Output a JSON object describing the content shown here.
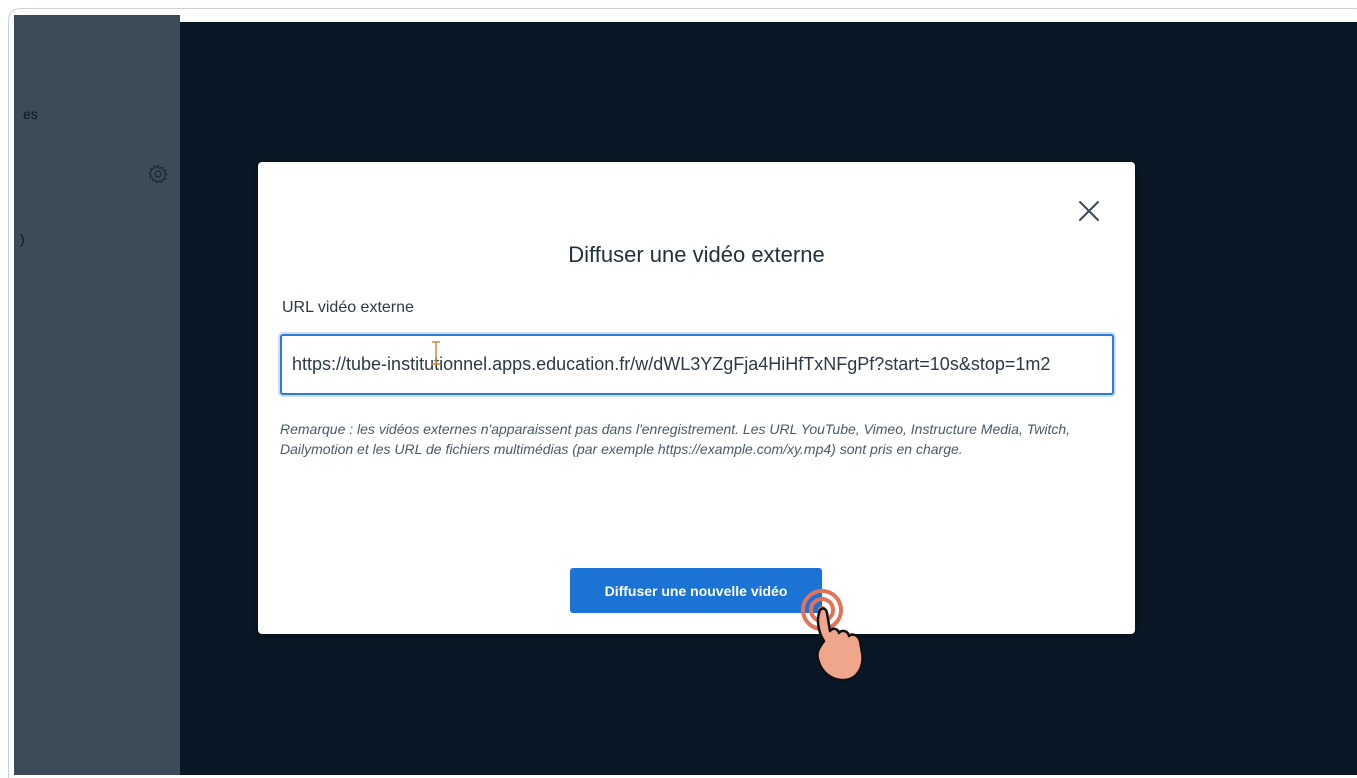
{
  "sidebar": {
    "partial_label_1": "es",
    "partial_label_2": ")",
    "settings_icon": "gear-icon"
  },
  "modal": {
    "title": "Diffuser une vidéo externe",
    "close_icon": "close-icon",
    "field_label": "URL vidéo externe",
    "url_value": "https://tube-institutionnel.apps.education.fr/w/dWL3YZgFja4HiHfTxNFgPf?start=10s&stop=1m2",
    "note": "Remarque : les vidéos externes n'apparaissent pas dans l'enregistrement. Les URL YouTube, Vimeo, Instructure Media, Twitch, Dailymotion et les URL de fichiers multimédias (par exemple https://example.com/xy.mp4) sont pris en charge.",
    "submit_label": "Diffuser une nouvelle vidéo"
  },
  "colors": {
    "sidebar": "#3d4b59",
    "backdrop": "#0a1726",
    "accent": "#1b73d6",
    "input_border": "#2e7ad6",
    "hand_cursor": "#f0a68c"
  }
}
